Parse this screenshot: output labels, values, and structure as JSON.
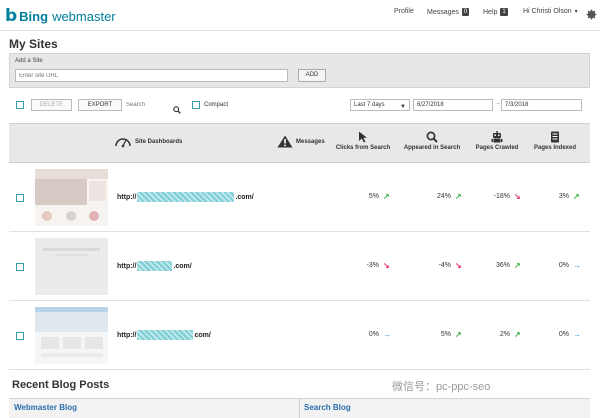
{
  "brand": {
    "b": "b",
    "name": "Bing",
    "product": "webmaster"
  },
  "nav": {
    "profile": "Profile",
    "messages": "Messages",
    "messages_count": "0",
    "help": "Help",
    "help_count": "1",
    "user": "Hi Christi Olson",
    "user_caret": "▾"
  },
  "page_title": "My Sites",
  "add_site": {
    "label": "Add a Site",
    "placeholder": "Enter site URL",
    "button": "ADD"
  },
  "toolbar": {
    "delete": "DELETE",
    "export": "EXPORT",
    "search_placeholder": "Search",
    "compact": "Compact",
    "range": "Last 7 days",
    "start_date": "6/27/2018",
    "dash": "-",
    "end_date": "7/3/2018"
  },
  "columns": {
    "dashboards": "Site Dashboards",
    "messages": "Messages",
    "clicks": "Clicks from Search",
    "appeared": "Appeared in Search",
    "crawled": "Pages Crawled",
    "indexed": "Pages Indexed"
  },
  "rows": [
    {
      "url_prefix": "http://",
      "url_suffix": ".com/",
      "clicks": "5%",
      "appeared": "24%",
      "crawled": "-18%",
      "indexed": "3%"
    },
    {
      "url_prefix": "http://",
      "url_suffix": ".com/",
      "clicks": "-3%",
      "appeared": "-4%",
      "crawled": "36%",
      "indexed": "0%"
    },
    {
      "url_prefix": "http://",
      "url_suffix": "com/",
      "clicks": "0%",
      "appeared": "5%",
      "crawled": "2%",
      "indexed": "0%"
    }
  ],
  "arrows": {
    "up": "↗",
    "down": "↘",
    "flat": "→"
  },
  "blog": {
    "title": "Recent Blog Posts",
    "tab1": "Webmaster Blog",
    "tab2": "Search Blog"
  },
  "watermark": "微信号：pc-ppc-seo"
}
